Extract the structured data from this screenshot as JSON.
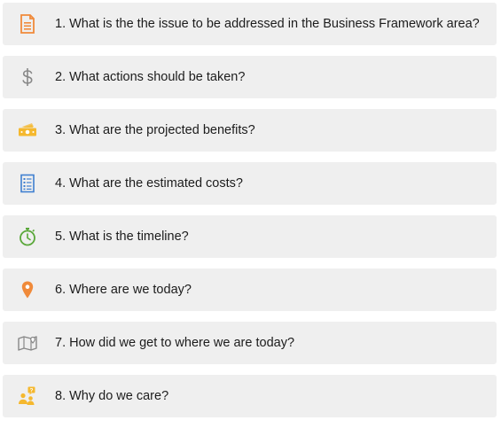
{
  "items": [
    {
      "label": "1. What is the the issue to be addressed in the Business Framework area?",
      "icon": "document-icon"
    },
    {
      "label": "2. What actions should be taken?",
      "icon": "dollar-icon"
    },
    {
      "label": "3. What are the projected benefits?",
      "icon": "money-icon"
    },
    {
      "label": "4. What are the estimated costs?",
      "icon": "checklist-icon"
    },
    {
      "label": "5. What is the timeline?",
      "icon": "stopwatch-icon"
    },
    {
      "label": "6. Where are we today?",
      "icon": "location-pin-icon"
    },
    {
      "label": "7. How did we get to where we are today?",
      "icon": "map-icon"
    },
    {
      "label": "8. Why do we care?",
      "icon": "people-question-icon"
    }
  ],
  "colors": {
    "orange": "#f08a3a",
    "yellow": "#f5b82e",
    "blue": "#3f7fd0",
    "green": "#5aa83a",
    "gray": "#888888",
    "row_bg": "#efefef"
  }
}
